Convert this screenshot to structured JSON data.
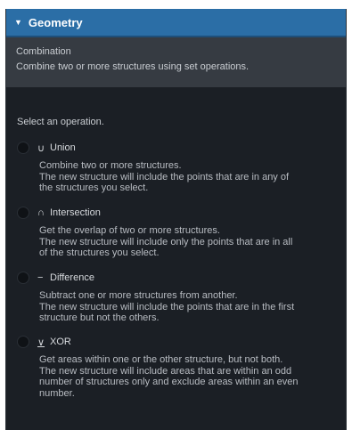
{
  "panel": {
    "title": "Geometry",
    "caret_icon": "caret-down-icon"
  },
  "info": {
    "title": "Combination",
    "description": "Combine two or more structures using set operations."
  },
  "prompt": "Select an operation.",
  "operations": [
    {
      "symbol": "∪",
      "label": "Union",
      "desc": [
        "Combine two or more structures.",
        "The new structure will include the points that are in any of",
        "the structures you select."
      ]
    },
    {
      "symbol": "∩",
      "label": "Intersection",
      "desc": [
        "Get the overlap of two or more structures.",
        "The new structure will include only the points that are in all",
        "of the structures you select."
      ]
    },
    {
      "symbol": "−",
      "label": "Difference",
      "desc": [
        "Subtract one or more structures from another.",
        "The new structure will include the points that are in the first",
        "structure but not the others."
      ]
    },
    {
      "symbol": "∨",
      "label": "XOR",
      "desc": [
        "Get areas within one or the other structure, but not both.",
        "The new structure will include areas that are within an odd",
        "number of structures only and exclude areas within an even",
        "number."
      ]
    }
  ],
  "colors": {
    "header": "#2b6ea6",
    "background": "#1b1f25",
    "info_box": "#363b42"
  }
}
